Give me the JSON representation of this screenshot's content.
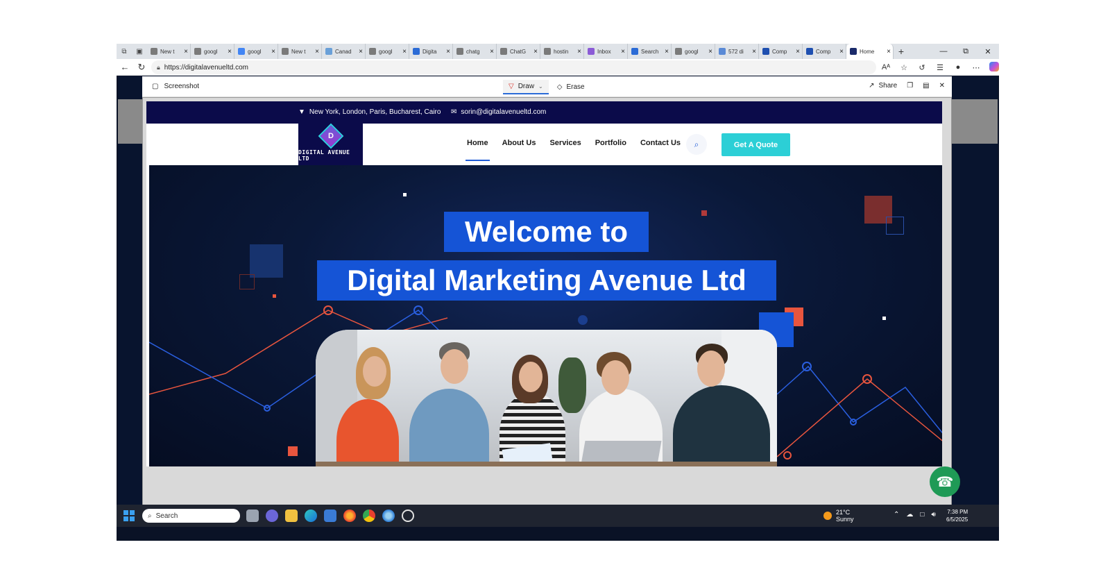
{
  "browser": {
    "tabs": [
      {
        "title": "New t",
        "favicon": "page-icon",
        "color": "#7a7a7a"
      },
      {
        "title": "googl",
        "favicon": "search-icon",
        "color": "#7a7a7a"
      },
      {
        "title": "googl",
        "favicon": "google-icon",
        "color": "#4285f4"
      },
      {
        "title": "New t",
        "favicon": "page-icon",
        "color": "#7a7a7a"
      },
      {
        "title": "Canad",
        "favicon": "image-icon",
        "color": "#6aa0d8"
      },
      {
        "title": "googl",
        "favicon": "search-icon",
        "color": "#7a7a7a"
      },
      {
        "title": "Digita",
        "favicon": "w-icon",
        "color": "#2b6bd6"
      },
      {
        "title": "chatg",
        "favicon": "search-icon",
        "color": "#7a7a7a"
      },
      {
        "title": "ChatG",
        "favicon": "chat-icon",
        "color": "#7a7a7a"
      },
      {
        "title": "hostin",
        "favicon": "search-icon",
        "color": "#7a7a7a"
      },
      {
        "title": "Inbox",
        "favicon": "mail-icon",
        "color": "#8b5bd6"
      },
      {
        "title": "Search",
        "favicon": "w-icon",
        "color": "#2b6bd6"
      },
      {
        "title": "googl",
        "favicon": "search-icon",
        "color": "#7a7a7a"
      },
      {
        "title": "572 di",
        "favicon": "w-icon",
        "color": "#5a8ad6"
      },
      {
        "title": "Comp",
        "favicon": "w-icon",
        "color": "#1e4fb0"
      },
      {
        "title": "Comp",
        "favicon": "w-icon",
        "color": "#1e4fb0"
      },
      {
        "title": "Home",
        "favicon": "site-icon",
        "color": "#1a2a6a",
        "active": true
      }
    ],
    "url": "https://digitalavenueltd.com"
  },
  "screenshot_tool": {
    "title": "Screenshot",
    "draw_label": "Draw",
    "erase_label": "Erase",
    "share_label": "Share"
  },
  "site": {
    "topbar": {
      "location": "New York, London, Paris, Bucharest, Cairo",
      "email": "sorin@digitalavenueltd.com"
    },
    "logo": {
      "letter": "D",
      "text": "DIGITAL AVENUE LTD"
    },
    "nav": [
      "Home",
      "About Us",
      "Services",
      "Portfolio",
      "Contact Us"
    ],
    "cta": "Get A Quote",
    "hero": {
      "line1": "Welcome to",
      "line2": "Digital Marketing Avenue Ltd"
    }
  },
  "taskbar": {
    "search_placeholder": "Search",
    "weather_temp": "21°C",
    "weather_desc": "Sunny",
    "time": "7:38 PM",
    "date": "6/5/2025"
  },
  "colors": {
    "brand_navy": "#0b0b4a",
    "hero_blue": "#1554d6",
    "cta_teal": "#2ccfd6",
    "accent_red": "#e8553e"
  }
}
